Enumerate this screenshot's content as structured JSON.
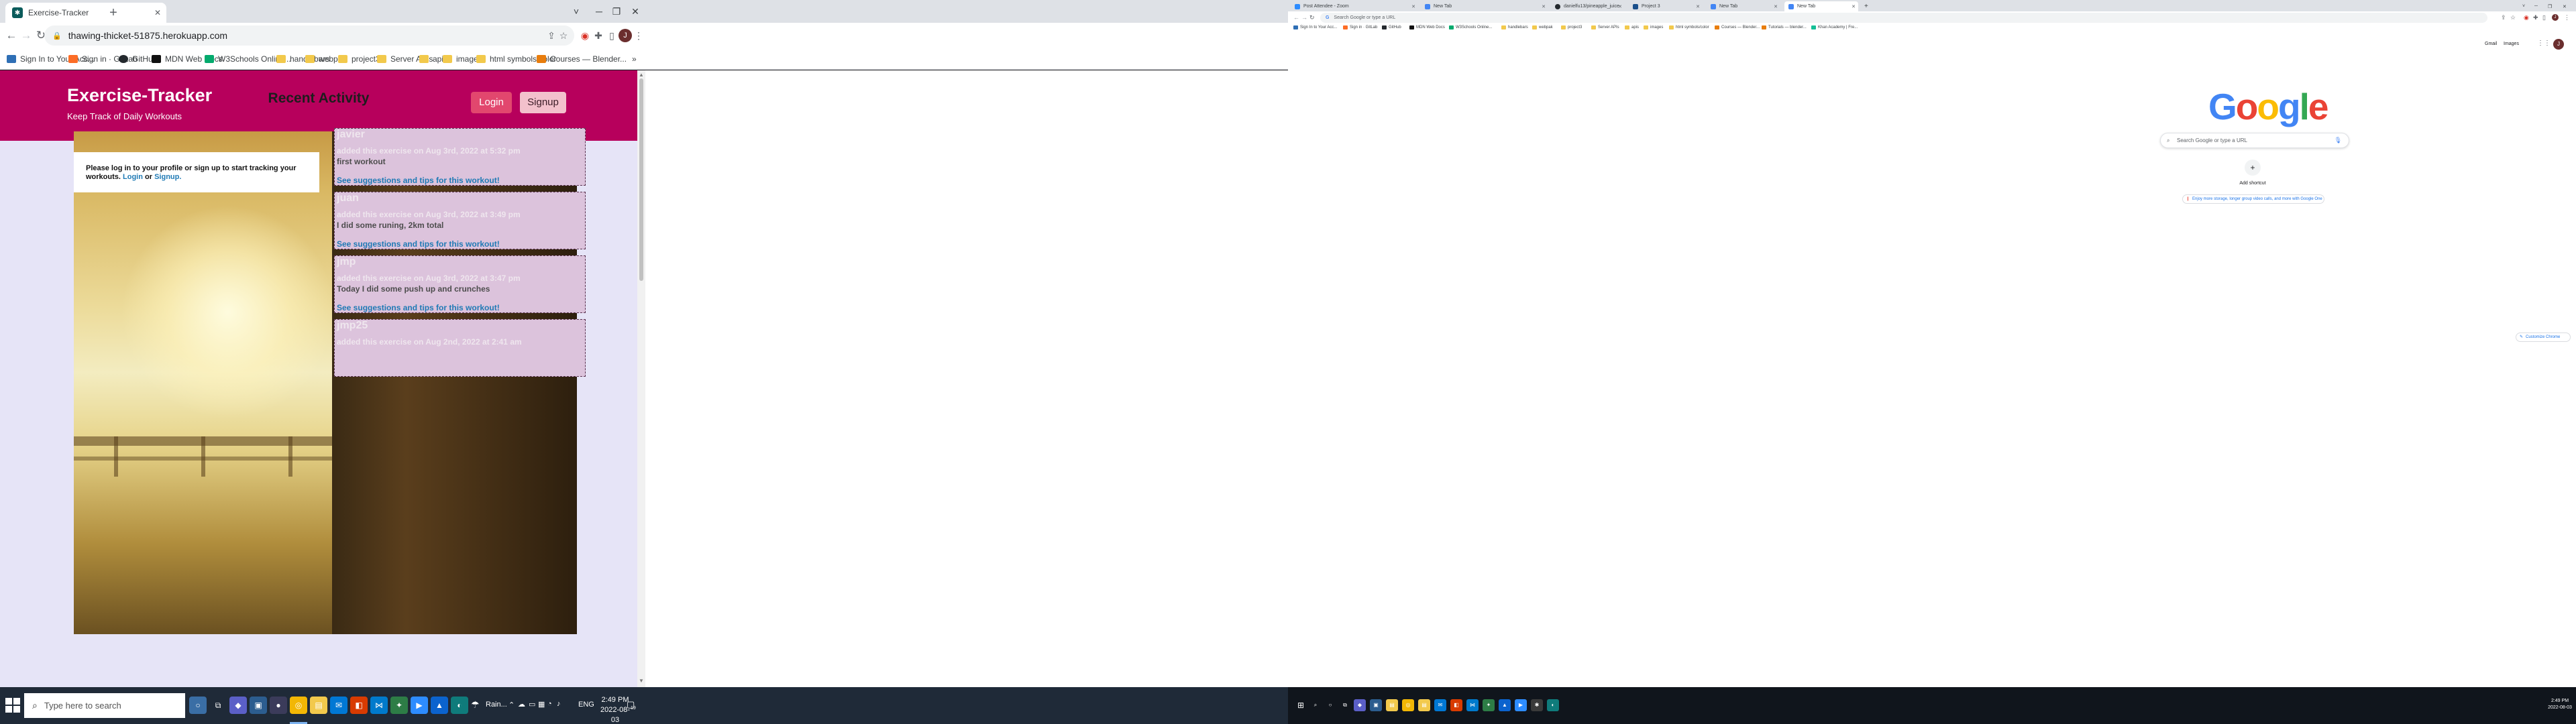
{
  "left_browser": {
    "tabs": [
      {
        "title": "Exercise-Tracker",
        "active": true
      }
    ],
    "new_tab_symbol": "+",
    "window_controls": [
      "˅",
      "─",
      "❐",
      "✕"
    ],
    "url": "thawing-thicket-51875.herokuapp.com",
    "bookmarks": [
      "Sign In to Your Acc...",
      "Sign in · GitLab",
      "GitHub",
      "MDN Web Docs",
      "W3Schools Online...",
      "handlebars",
      "webpak",
      "project3",
      "Server APIs",
      "apis",
      "images",
      "html symbols/color",
      "Courses — Blender..."
    ],
    "bookmarks_overflow": "»"
  },
  "site": {
    "title": "Exercise-Tracker",
    "subtitle": "Keep Track of Daily Workouts",
    "login_label": "Login",
    "signup_label": "Signup",
    "recent_heading": "Recent Activity",
    "login_prompt_text": "Please log in to your profile or sign up to start tracking your workouts.",
    "login_prompt_login": "Login",
    "login_prompt_or": "or",
    "login_prompt_signup": "Signup.",
    "activities": [
      {
        "user": "javier",
        "meta": "added this exercise on Aug 3rd, 2022 at 5:32 pm",
        "description": "first workout",
        "tips": "See suggestions and tips for this workout!"
      },
      {
        "user": "juan",
        "meta": "added this exercise on Aug 3rd, 2022 at 3:49 pm",
        "description": "I did some runing, 2km total",
        "tips": "See suggestions and tips for this workout!"
      },
      {
        "user": "jmp",
        "meta": "added this exercise on Aug 3rd, 2022 at 3:47 pm",
        "description": "Today I did some push up and crunches",
        "tips": "See suggestions and tips for this workout!"
      },
      {
        "user": "jmp25",
        "meta": "added this exercise on Aug 2nd, 2022 at 2:41 am",
        "description": "",
        "tips": ""
      }
    ]
  },
  "left_taskbar": {
    "search_placeholder": "Type here to search",
    "weather_label": "Rain...",
    "language": "ENG",
    "time": "2:49 PM",
    "date": "2022-08-03",
    "notification_count": "19"
  },
  "right_browser": {
    "tabs": [
      {
        "title": "Post Attendee - Zoom",
        "active": false
      },
      {
        "title": "New Tab",
        "active": false
      },
      {
        "title": "danielfu13/pineapple_juice",
        "active": false
      },
      {
        "title": "Project 3",
        "active": false
      },
      {
        "title": "New Tab",
        "active": false
      },
      {
        "title": "New Tab",
        "active": true
      }
    ],
    "new_tab_symbol": "+",
    "omnibox_placeholder": "Search Google or type a URL",
    "bookmarks": [
      "Sign In to Your Acc...",
      "Sign in · GitLab",
      "GitHub",
      "MDN Web Docs",
      "W3Schools Online...",
      "handlebars",
      "webpak",
      "project3",
      "Server APIs",
      "apis",
      "images",
      "html symbols/color",
      "Courses — Blender...",
      "Tutorials — blender...",
      "Khan Academy | Fre..."
    ],
    "top_links": [
      "Gmail",
      "Images"
    ],
    "avatar_letter": "J",
    "google_letters": [
      "G",
      "o",
      "o",
      "g",
      "l",
      "e"
    ],
    "search_placeholder": "Search Google or type a URL",
    "shortcut_symbol": "+",
    "shortcut_label": "Add shortcut",
    "promo_text": "Enjoy more storage, longer group video calls, and more with Google One",
    "customize_label": "Customize Chrome",
    "time": "2:49 PM",
    "date": "2022-08-03"
  },
  "colors": {
    "site_header": "#b7005c",
    "login_button": "#e2476e",
    "signup_button": "#f3c1cc",
    "page_background": "#e6e4f7",
    "card_background": "#dcc3dc",
    "link": "#1f7ab5",
    "google_blue": "#4285f4",
    "google_red": "#ea4335",
    "google_yellow": "#fbbc05",
    "google_green": "#34a853"
  }
}
